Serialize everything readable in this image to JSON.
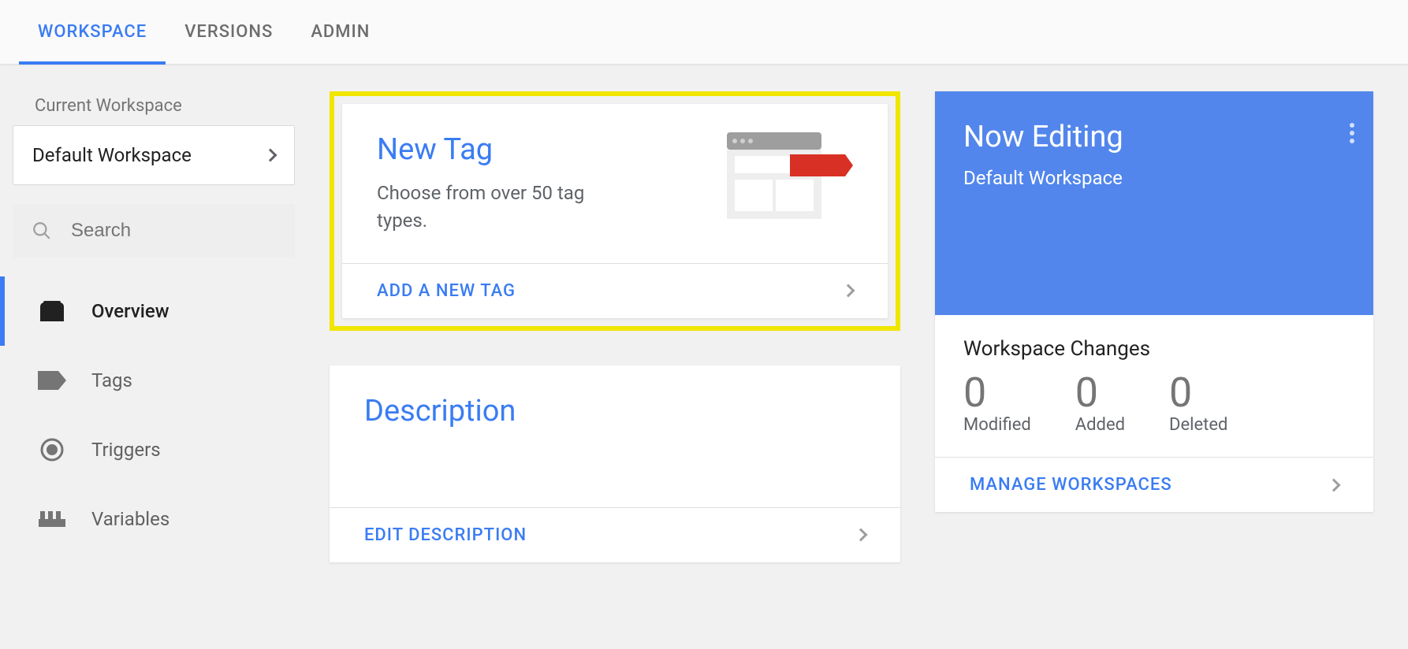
{
  "nav": {
    "workspace": "WORKSPACE",
    "versions": "VERSIONS",
    "admin": "ADMIN"
  },
  "sidebar": {
    "current_workspace_label": "Current Workspace",
    "current_workspace_value": "Default Workspace",
    "search_placeholder": "Search",
    "items": {
      "overview": "Overview",
      "tags": "Tags",
      "triggers": "Triggers",
      "variables": "Variables"
    }
  },
  "newtag": {
    "title": "New Tag",
    "subtitle": "Choose from over 50 tag types.",
    "action": "ADD A NEW TAG"
  },
  "description": {
    "title": "Description",
    "action": "EDIT DESCRIPTION"
  },
  "editing": {
    "title": "Now Editing",
    "subtitle": "Default Workspace",
    "changes_title": "Workspace Changes",
    "modified_count": "0",
    "modified_label": "Modified",
    "added_count": "0",
    "added_label": "Added",
    "deleted_count": "0",
    "deleted_label": "Deleted",
    "action": "MANAGE WORKSPACES"
  }
}
